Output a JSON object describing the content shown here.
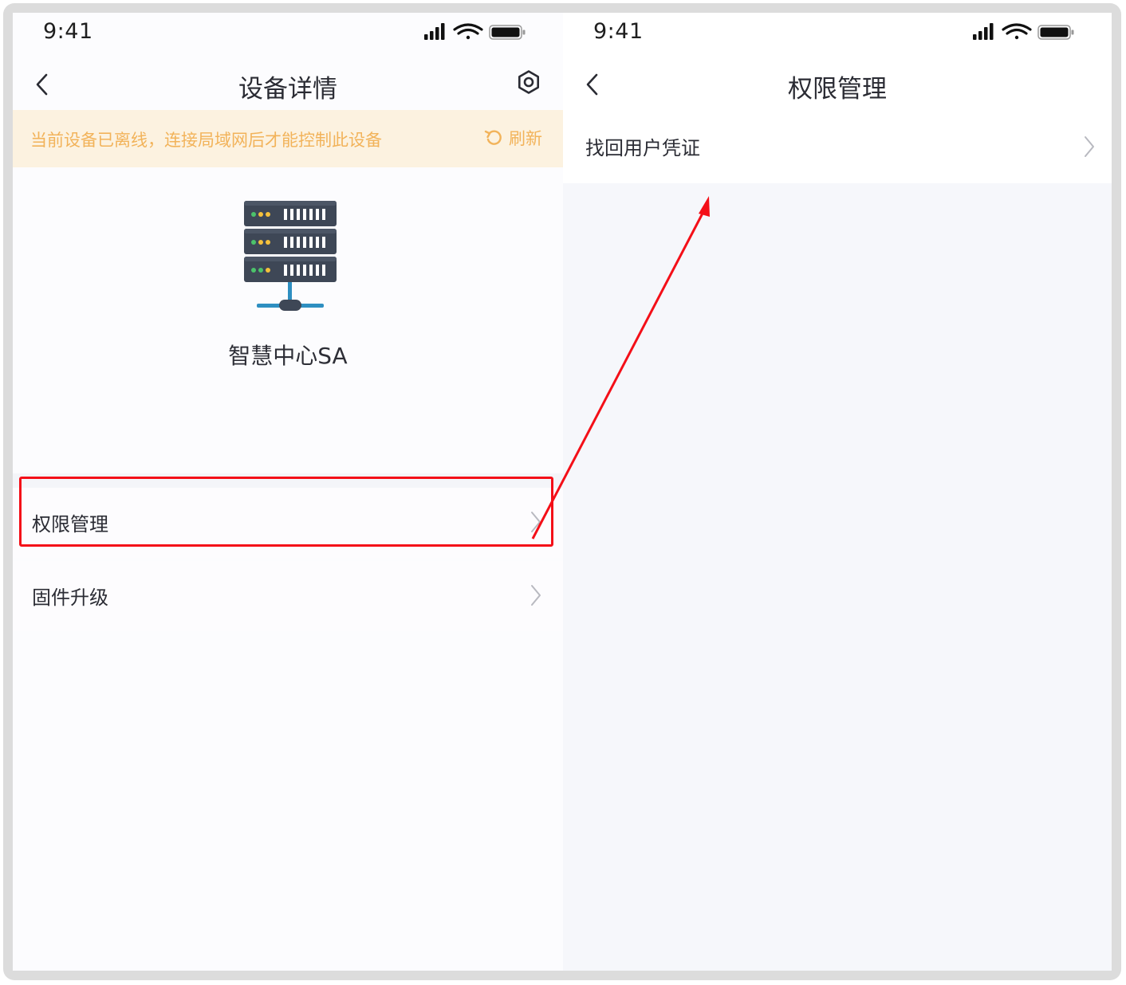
{
  "left_screen": {
    "status": {
      "time": "9:41"
    },
    "nav": {
      "title": "设备详情",
      "back_icon": "chevron-left-icon",
      "settings_icon": "gear-icon"
    },
    "banner": {
      "message": "当前设备已离线，连接局域网后才能控制此设备",
      "action_label": "刷新",
      "action_icon": "refresh-icon"
    },
    "device": {
      "name": "智慧中心SA",
      "icon": "server-rack-icon"
    },
    "list": [
      {
        "label": "权限管理"
      },
      {
        "label": "固件升级"
      }
    ]
  },
  "right_screen": {
    "status": {
      "time": "9:41"
    },
    "nav": {
      "title": "权限管理",
      "back_icon": "chevron-left-icon"
    },
    "list": [
      {
        "label": "找回用户凭证"
      }
    ]
  },
  "colors": {
    "banner_bg": "#fcf2e0",
    "banner_text": "#f2b35a",
    "highlight": "#f40f18",
    "text_primary": "#2b2c34",
    "page_bg": "#f6f7fb"
  },
  "annotation": {
    "type": "red-highlight-box-with-arrow",
    "from": "权限管理",
    "to": "找回用户凭证"
  }
}
